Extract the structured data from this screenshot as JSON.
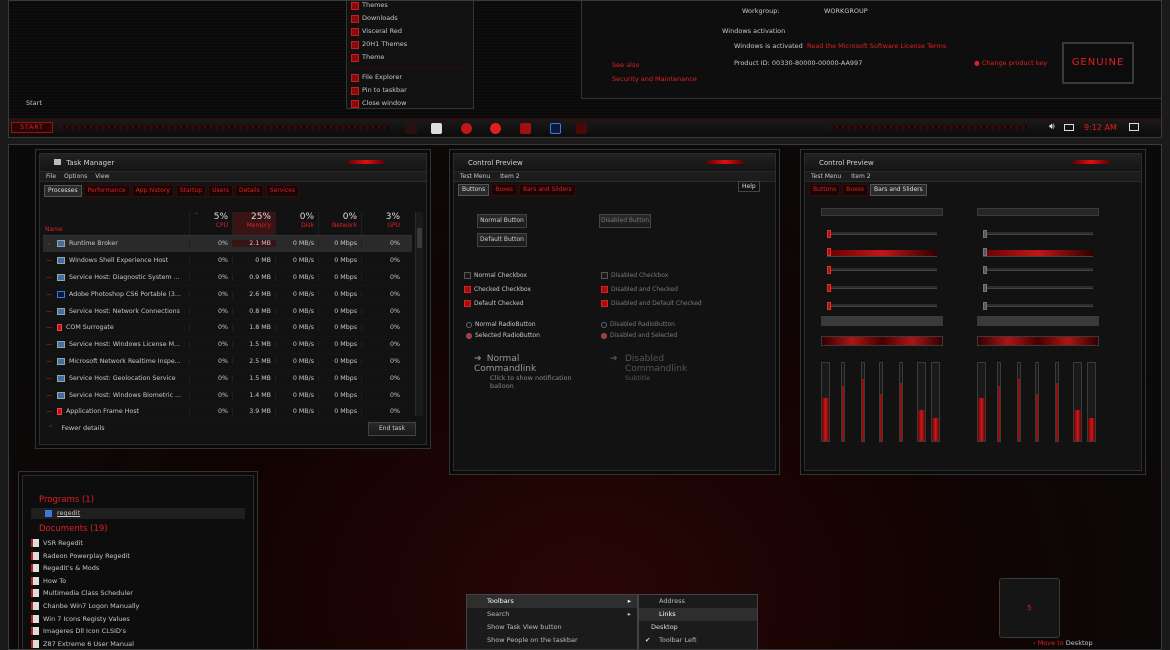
{
  "start_menu": {
    "items": [
      "Themes",
      "Downloads",
      "Visceral Red",
      "20H1 Themes",
      "Theme"
    ],
    "context": [
      "File Explorer",
      "Pin to taskbar",
      "Close window"
    ]
  },
  "desktop_start_label": "Start",
  "taskbar": {
    "start_label": "START",
    "clock": "9:12 AM"
  },
  "system": {
    "workgroup_label": "Workgroup:",
    "workgroup_value": "WORKGROUP",
    "activation_heading": "Windows activation",
    "activated_text": "Windows is activated",
    "license_link": "Read the Microsoft Software License Terms",
    "product_id": "Product ID: 00330-80000-00000-AA997",
    "change_key": "Change product key",
    "genuine": "GENUINE",
    "see_also": "See also",
    "security": "Security and Maintenance"
  },
  "task_manager": {
    "title": "Task Manager",
    "menu": [
      "File",
      "Options",
      "View"
    ],
    "tabs": [
      "Processes",
      "Performance",
      "App history",
      "Startup",
      "Users",
      "Details",
      "Services"
    ],
    "columns": [
      {
        "pct": "5%",
        "label": "CPU"
      },
      {
        "pct": "25%",
        "label": "Memory"
      },
      {
        "pct": "0%",
        "label": "Disk"
      },
      {
        "pct": "0%",
        "label": "Network"
      },
      {
        "pct": "3%",
        "label": "GPU"
      }
    ],
    "name_header": "Name",
    "rows": [
      {
        "name": "Runtime Broker",
        "cpu": "0%",
        "mem": "2.1 MB",
        "disk": "0 MB/s",
        "net": "0 Mbps",
        "gpu": "0%",
        "icon": "window"
      },
      {
        "name": "Windows Shell Experience Host",
        "cpu": "0%",
        "mem": "0 MB",
        "disk": "0 MB/s",
        "net": "0 Mbps",
        "gpu": "0%",
        "icon": "window"
      },
      {
        "name": "Service Host: Diagnostic System ...",
        "cpu": "0%",
        "mem": "0.9 MB",
        "disk": "0 MB/s",
        "net": "0 Mbps",
        "gpu": "0%",
        "icon": "window"
      },
      {
        "name": "Adobe Photoshop CS6 Portable (3...",
        "cpu": "0%",
        "mem": "2.6 MB",
        "disk": "0 MB/s",
        "net": "0 Mbps",
        "gpu": "0%",
        "icon": "ps"
      },
      {
        "name": "Service Host: Network Connections",
        "cpu": "0%",
        "mem": "0.8 MB",
        "disk": "0 MB/s",
        "net": "0 Mbps",
        "gpu": "0%",
        "icon": "window"
      },
      {
        "name": "COM Surrogate",
        "cpu": "0%",
        "mem": "1.8 MB",
        "disk": "0 MB/s",
        "net": "0 Mbps",
        "gpu": "0%",
        "icon": "red"
      },
      {
        "name": "Service Host: Windows License M...",
        "cpu": "0%",
        "mem": "1.5 MB",
        "disk": "0 MB/s",
        "net": "0 Mbps",
        "gpu": "0%",
        "icon": "window"
      },
      {
        "name": "Microsoft Network Realtime Inspe...",
        "cpu": "0%",
        "mem": "2.5 MB",
        "disk": "0 MB/s",
        "net": "0 Mbps",
        "gpu": "0%",
        "icon": "window"
      },
      {
        "name": "Service Host: Geolocation Service",
        "cpu": "0%",
        "mem": "1.5 MB",
        "disk": "0 MB/s",
        "net": "0 Mbps",
        "gpu": "0%",
        "icon": "window"
      },
      {
        "name": "Service Host: Windows Biometric ...",
        "cpu": "0%",
        "mem": "1.4 MB",
        "disk": "0 MB/s",
        "net": "0 Mbps",
        "gpu": "0%",
        "icon": "window"
      },
      {
        "name": "Application Frame Host",
        "cpu": "0%",
        "mem": "3.9 MB",
        "disk": "0 MB/s",
        "net": "0 Mbps",
        "gpu": "0%",
        "icon": "red"
      }
    ],
    "fewer_details": "Fewer details",
    "end_task": "End task"
  },
  "preview1": {
    "title": "Control Preview",
    "menu": [
      "Test Menu",
      "Item 2"
    ],
    "help": "Help",
    "tabs": [
      "Buttons",
      "Boxes",
      "Bars and Sliders"
    ],
    "normal_button": "Normal Button",
    "default_button": "Default Button",
    "disabled_button": "Disabled Button",
    "checkboxes": [
      "Normal Checkbox",
      "Checked Checkbox",
      "Default Checked"
    ],
    "disabled_checkboxes": [
      "Disabled Checkbox",
      "Disabled and Checked",
      "Disabled and Default Checked"
    ],
    "radios": [
      "Normal RadioButton",
      "Selected RadioButton"
    ],
    "disabled_radios": [
      "Disabled RadioButton",
      "Disabled and Selected"
    ],
    "cmdlink_title": "Normal Commandlink",
    "cmdlink_sub": "Click to show notification balloon",
    "cmdlink_dis_title": "Disabled Commandlink",
    "cmdlink_dis_sub": "Subtitle"
  },
  "preview2": {
    "title": "Control Preview",
    "menu": [
      "Test Menu",
      "Item 2"
    ],
    "tabs": [
      "Buttons",
      "Boxes",
      "Bars and Sliders"
    ]
  },
  "search": {
    "programs_heading": "Programs (1)",
    "programs": [
      "regedit"
    ],
    "documents_heading": "Documents (19)",
    "documents": [
      "VSR Regedit",
      "Radeon Powerplay Regedit",
      "Regedit's & Mods",
      "How To",
      "Multimedia Class Scheduler",
      "Chanbe Win7 Logon Manually",
      "Win 7 Icons Registy Values",
      "Imageres Dll Icon CLSID's",
      "Z87 Extreme 6 User Manual"
    ]
  },
  "context_menu": {
    "items": [
      "Toolbars",
      "Search",
      "Show Task View button",
      "Show People on the taskbar"
    ],
    "submenu": [
      "Address",
      "Links",
      "Desktop",
      "Toolbar Left"
    ]
  },
  "desktop_tile": {
    "label": "5"
  },
  "move_to_desktop": {
    "prefix": "Move to",
    "target": "Desktop"
  },
  "colors": {
    "accent": "#e02020",
    "panel": "#121212",
    "bg": "#0a0a0a"
  }
}
